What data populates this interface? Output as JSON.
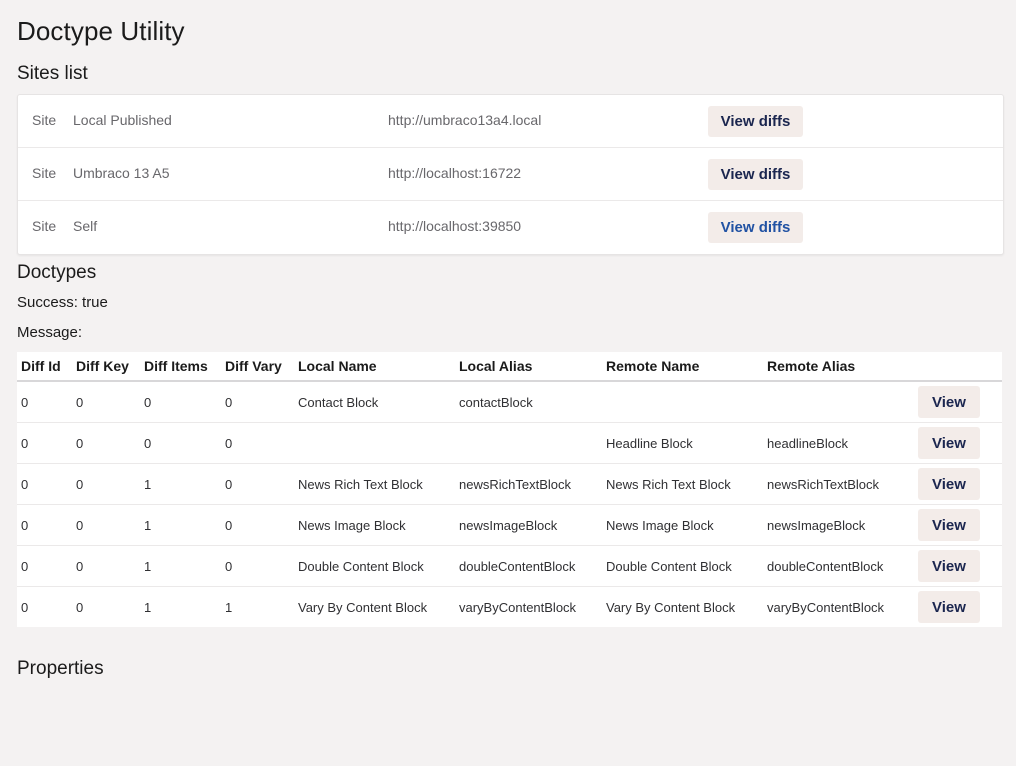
{
  "title": "Doctype Utility",
  "sites": {
    "heading": "Sites list",
    "button_label": "View diffs",
    "rows": [
      {
        "label": "Site",
        "name": "Local Published",
        "url": "http://umbraco13a4.local"
      },
      {
        "label": "Site",
        "name": "Umbraco 13 A5",
        "url": "http://localhost:16722"
      },
      {
        "label": "Site",
        "name": "Self",
        "url": "http://localhost:39850"
      }
    ]
  },
  "doctypes": {
    "heading": "Doctypes",
    "success": "Success: true",
    "message": "Message:",
    "button_label": "View",
    "columns": [
      "Diff Id",
      "Diff Key",
      "Diff Items",
      "Diff Vary",
      "Local Name",
      "Local Alias",
      "Remote Name",
      "Remote Alias"
    ],
    "rows": [
      [
        "0",
        "0",
        "0",
        "0",
        "Contact Block",
        "contactBlock",
        "",
        ""
      ],
      [
        "0",
        "0",
        "0",
        "0",
        "",
        "",
        "Headline Block",
        "headlineBlock"
      ],
      [
        "0",
        "0",
        "1",
        "0",
        "News Rich Text Block",
        "newsRichTextBlock",
        "News Rich Text Block",
        "newsRichTextBlock"
      ],
      [
        "0",
        "0",
        "1",
        "0",
        "News Image Block",
        "newsImageBlock",
        "News Image Block",
        "newsImageBlock"
      ],
      [
        "0",
        "0",
        "1",
        "0",
        "Double Content Block",
        "doubleContentBlock",
        "Double Content Block",
        "doubleContentBlock"
      ],
      [
        "0",
        "0",
        "1",
        "1",
        "Vary By Content Block",
        "varyByContentBlock",
        "Vary By Content Block",
        "varyByContentBlock"
      ]
    ]
  },
  "properties": {
    "heading": "Properties"
  },
  "colors": {
    "background": "#f4f2f2",
    "button_bg": "#f3ece9",
    "button_text": "#1b264f",
    "button_focus_text": "#2152a3"
  }
}
